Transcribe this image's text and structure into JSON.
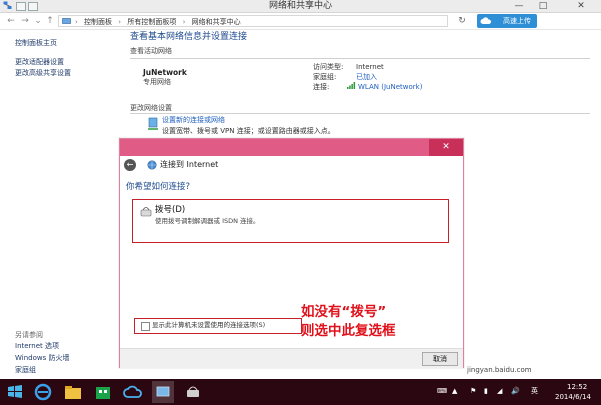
{
  "window": {
    "title": "网络和共享中心",
    "controls": {
      "minimize": "—",
      "maximize": "□",
      "close": "✕"
    }
  },
  "address": {
    "crumbs": [
      "控制面板",
      "所有控制面板项",
      "网络和共享中心"
    ],
    "upload_label": "高速上传"
  },
  "left_pane": {
    "items": [
      "控制面板主页",
      "更改适配器设置",
      "更改高级共享设置"
    ],
    "see_also_title": "另请参阅",
    "see_also": [
      "Internet 选项",
      "Windows 防火墙",
      "家庭组"
    ]
  },
  "main": {
    "heading": "查看基本网络信息并设置连接",
    "active_networks_title": "查看活动网络",
    "network_name": "JuNetwork",
    "network_type": "专用网络",
    "access_type_label": "访问类型:",
    "access_type_value": "Internet",
    "homegroup_label": "家庭组:",
    "homegroup_value": "已加入",
    "connection_label": "连接:",
    "connection_value": "WLAN (JuNetwork)",
    "change_settings_title": "更改网络设置",
    "setup_link": "设置新的连接或网络",
    "setup_desc": "设置宽带、拨号或 VPN 连接；或设置路由器或接入点。"
  },
  "dialog": {
    "title": "连接到 Internet",
    "question": "你希望如何连接?",
    "dial_title": "拨号(D)",
    "dial_desc": "使用拨号调制解调器或 ISDN 连接。",
    "checkbox_label": "显示此计算机未设置使用的连接选项(S)",
    "annotation_line1": "如没有“拨号”",
    "annotation_line2": "则选中此复选框",
    "cancel_label": "取消",
    "close_symbol": "✕"
  },
  "taskbar": {
    "time": "12:52",
    "date": "2014/6/14",
    "ime": "英",
    "watermark": "jingyan.baidu.com"
  },
  "colors": {
    "dialog_title": "#e05c86",
    "dialog_close": "#c8305a",
    "annotation": "#e0101a",
    "highlight_border": "#c8202a",
    "link": "#1f5fbf",
    "taskbar": "#2a0711"
  }
}
